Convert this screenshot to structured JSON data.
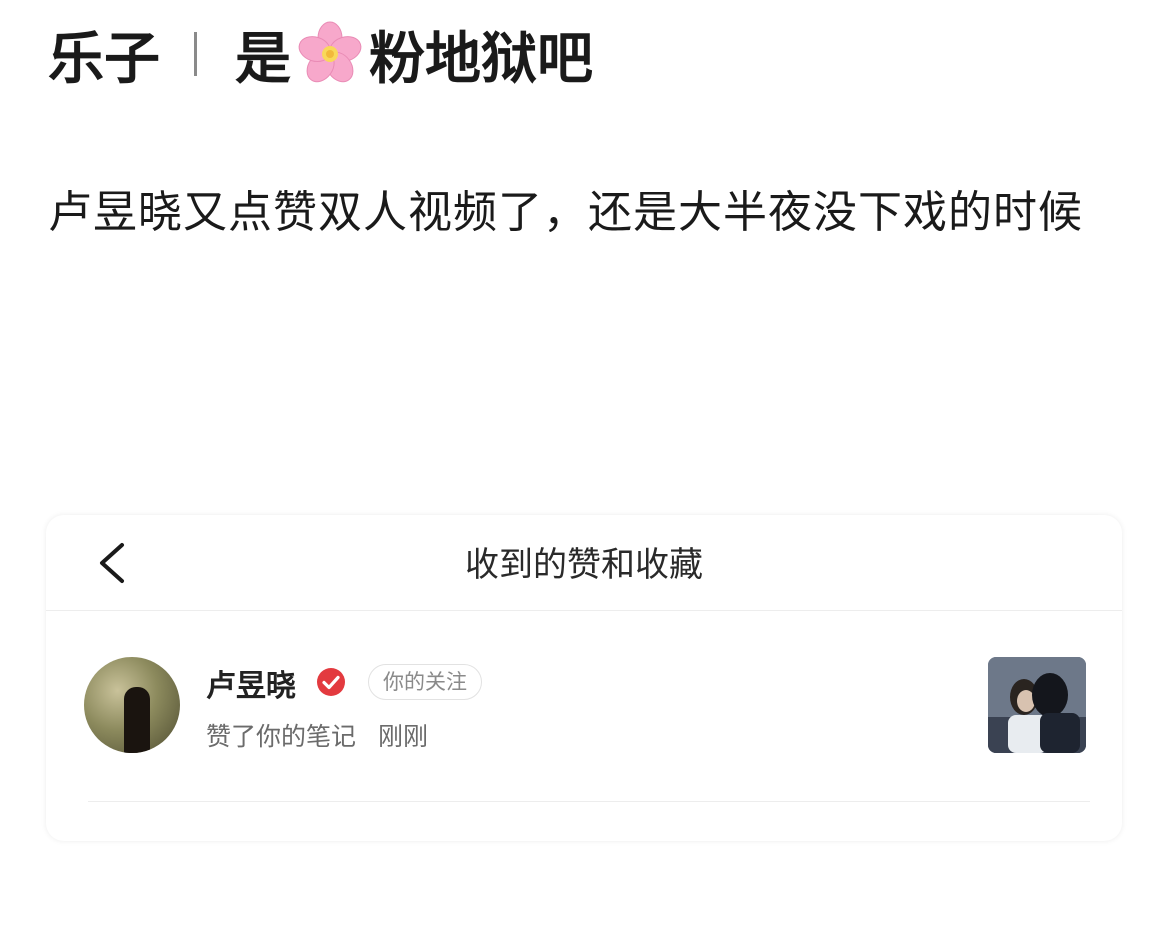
{
  "post": {
    "source_name": "乐子",
    "topic_prefix": "是",
    "topic_suffix": "粉地狱吧",
    "body_text": "卢昱晓又点赞双人视频了，还是大半夜没下戏的时候"
  },
  "notification_card": {
    "nav_title": "收到的赞和收藏",
    "item": {
      "username": "卢昱晓",
      "follow_tag": "你的关注",
      "action_text": "赞了你的笔记",
      "time_text": "刚刚"
    }
  },
  "colors": {
    "text_primary": "#1a1a1a",
    "text_secondary": "#6b6b6b",
    "verified_red": "#e33a3f",
    "flower_pink": "#f6a6c8"
  },
  "icons": {
    "topic_emoji": "cherry-blossom-icon",
    "back": "chevron-left-icon",
    "verified": "verified-check-icon"
  }
}
